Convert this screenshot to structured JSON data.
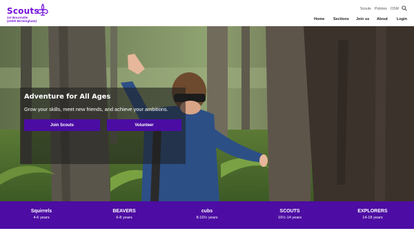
{
  "brand": {
    "name": "Scouts",
    "subtitle_line1": "1st Bournville",
    "subtitle_line2": "(100th Birmingham)",
    "color": "#7413dc"
  },
  "utility_nav": [
    "Scouts",
    "Policies",
    "OSM"
  ],
  "main_nav": [
    "Home",
    "Sections",
    "Join us",
    "About",
    "Login"
  ],
  "hero": {
    "title": "Adventure for All Ages",
    "subtitle": "Grow your skills, meet new friends, and achieve your ambitions.",
    "buttons": [
      "Join Scouts",
      "Volunteer"
    ],
    "button_color": "#4a0ca3"
  },
  "sections": [
    {
      "name": "Squirrels",
      "ages": "4-6 years"
    },
    {
      "name": "BEAVERS",
      "ages": "6-8 years"
    },
    {
      "name": "cubs",
      "ages": "8-10½ years"
    },
    {
      "name": "SCOUTS",
      "ages": "10½-14 years"
    },
    {
      "name": "EXPLORERS",
      "ages": "14-18 years"
    }
  ],
  "sections_bar_color": "#4d0ca3"
}
